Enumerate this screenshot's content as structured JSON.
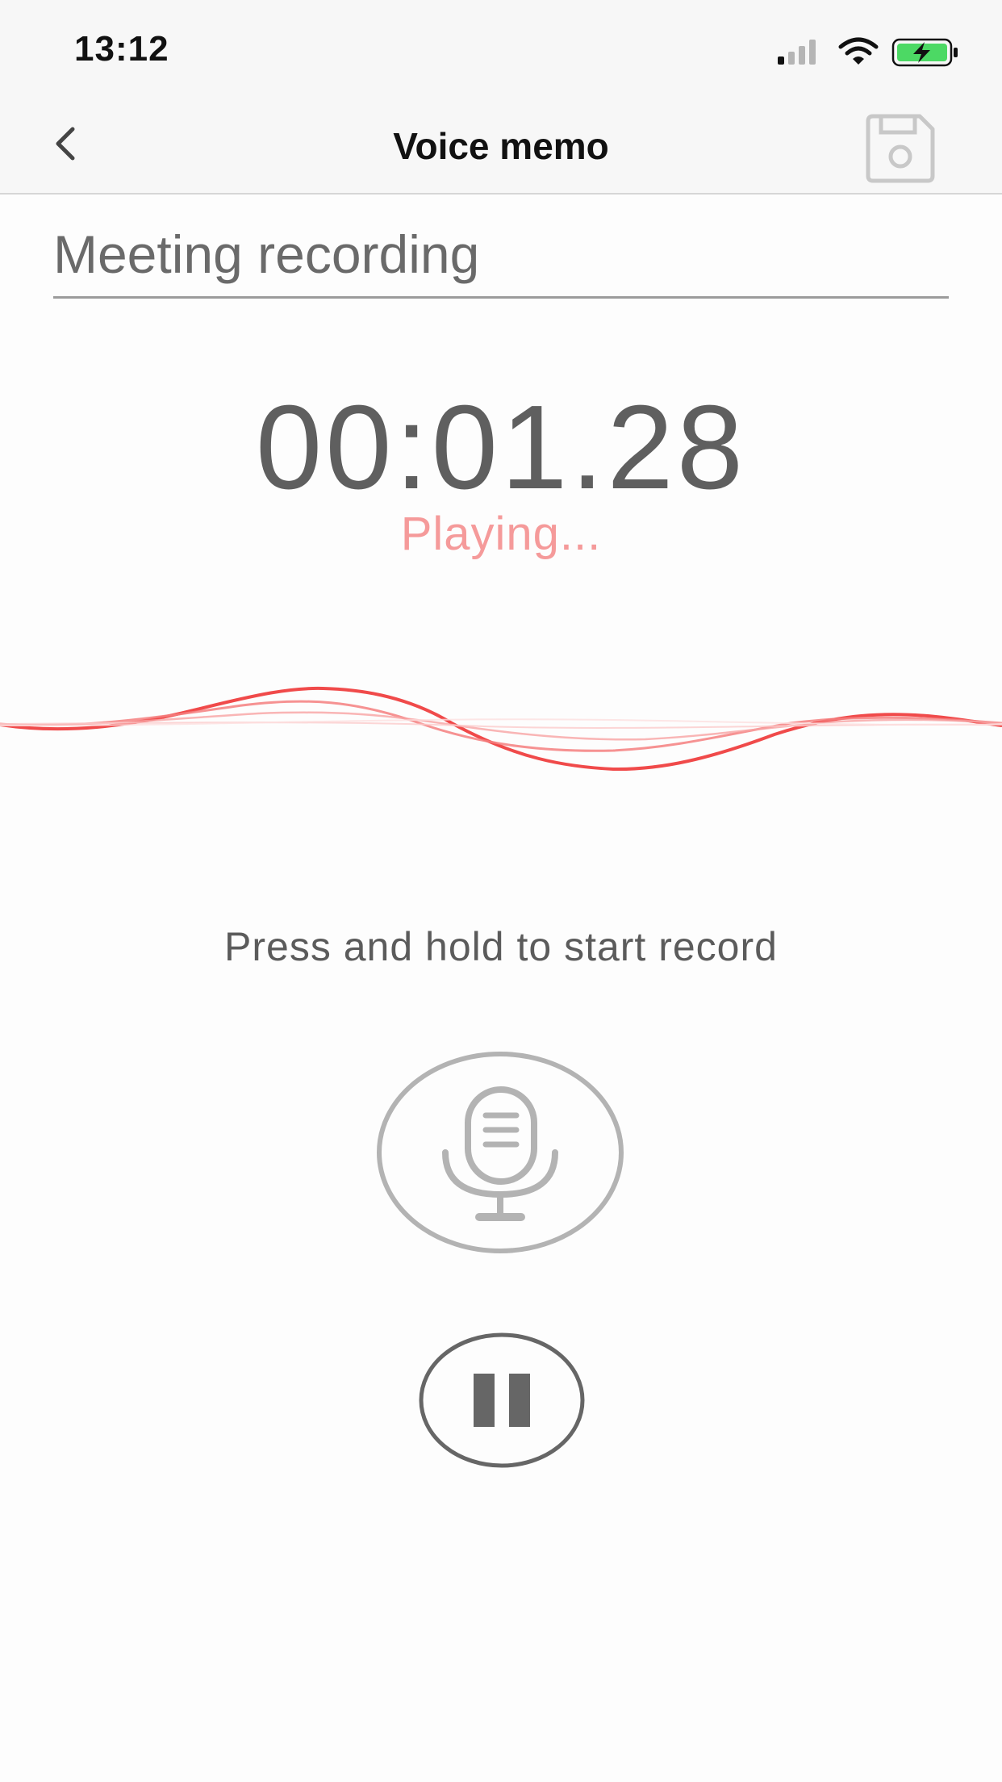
{
  "status_bar": {
    "time": "13:12",
    "icons": [
      "signal-icon",
      "wifi-icon",
      "battery-charging-icon"
    ]
  },
  "nav": {
    "title": "Voice memo",
    "back_icon": "chevron-left-icon",
    "save_icon": "floppy-disk-icon"
  },
  "memo": {
    "title_value": "Meeting recording"
  },
  "player": {
    "time": "00:01.28",
    "state": "Playing..."
  },
  "controls": {
    "hint": "Press and hold to start record",
    "record_icon": "microphone-icon",
    "pause_icon": "pause-icon"
  },
  "colors": {
    "accent": "#f04a4a",
    "status_text": "#f59a9a",
    "disabled_icon": "#c8c8c8",
    "button_outline": "#b3b3b3",
    "pause_outline": "#666666"
  }
}
